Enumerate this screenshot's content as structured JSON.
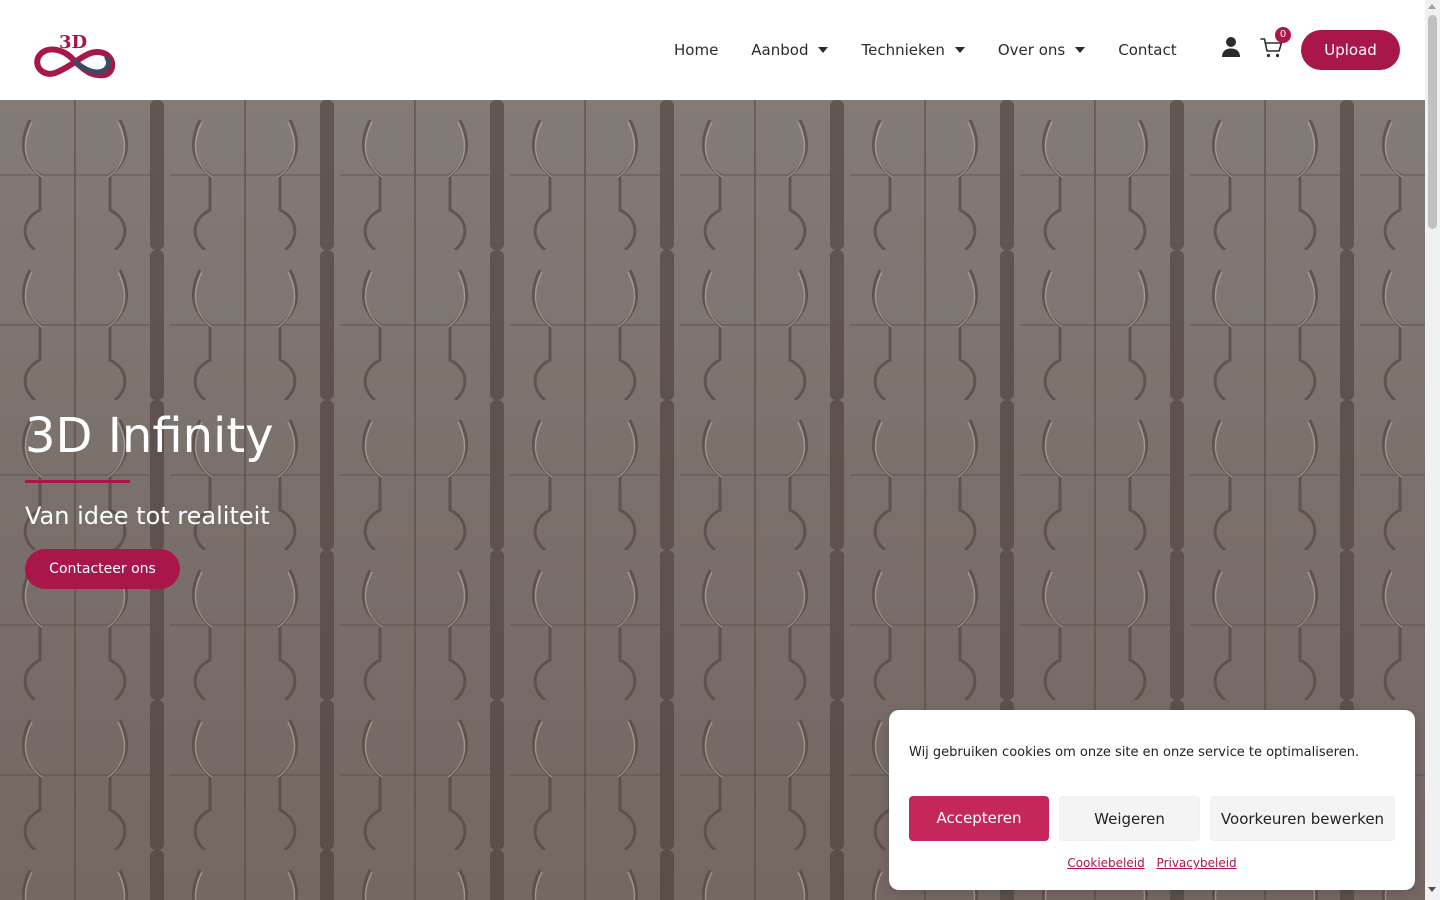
{
  "header": {
    "logo_text": "3D",
    "nav": [
      {
        "label": "Home",
        "has_dropdown": false
      },
      {
        "label": "Aanbod",
        "has_dropdown": true
      },
      {
        "label": "Technieken",
        "has_dropdown": true
      },
      {
        "label": "Over ons",
        "has_dropdown": true
      },
      {
        "label": "Contact",
        "has_dropdown": false
      }
    ],
    "user_icon": "user-icon",
    "cart_icon": "shopping-cart-icon",
    "cart_count": "0",
    "upload_label": "Upload"
  },
  "hero": {
    "title": "3D Infinity",
    "subtitle": "Van idee tot realiteit",
    "cta_label": "Contacteer ons"
  },
  "cookie_banner": {
    "message": "Wij gebruiken cookies om onze site en onze service te optimaliseren.",
    "accept_label": "Accepteren",
    "deny_label": "Weigeren",
    "preferences_label": "Voorkeuren bewerken",
    "links": [
      "Cookiebeleid",
      "Privacybeleid"
    ]
  },
  "colors": {
    "brand": "#a8164a",
    "accept_button": "#c5275b",
    "header_bg": "#ffffff",
    "text": "#2b2b2b"
  }
}
